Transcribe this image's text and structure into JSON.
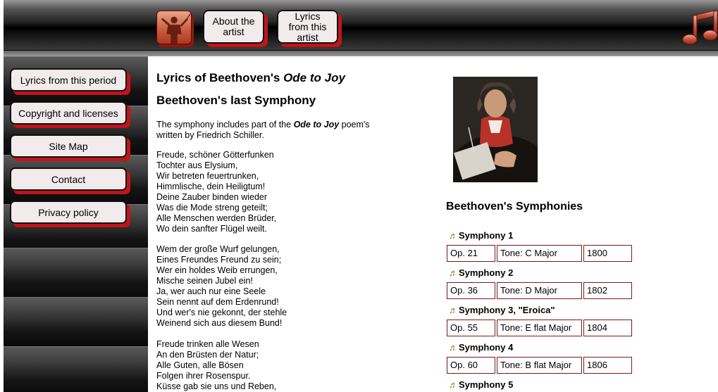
{
  "header": {
    "about_label": "About the artist",
    "lyrics_artist_label": "Lyrics from this artist",
    "logo_icon": "conductor-icon",
    "note_icon": "music-note-icon"
  },
  "sidebar": {
    "items": [
      {
        "label": "Lyrics from this period"
      },
      {
        "label": "Copyright and licenses"
      },
      {
        "label": "Site Map"
      },
      {
        "label": "Contact"
      },
      {
        "label": "Privacy policy"
      }
    ]
  },
  "main": {
    "title_prefix": "Lyrics of Beethoven's ",
    "title_italic": "Ode to Joy",
    "subtitle": "Beethoven's last Symphony",
    "intro_before": "The symphony includes part of the ",
    "intro_italic": "Ode to Joy",
    "intro_after": " poem's written by Friedrich Schiller.",
    "stanzas": [
      "Freude, schöner Götterfunken\nTochter aus Elysium,\nWir betreten feuertrunken,\nHimmlische, dein Heiligtum!\nDeine Zauber binden wieder\nWas die Mode streng geteilt;\nAlle Menschen werden Brüder,\nWo dein sanfter Flügel weilt.",
      "Wem der große Wurf gelungen,\nEines Freundes Freund zu sein;\nWer ein holdes Weib errungen,\nMische seinen Jubel ein!\nJa, wer auch nur eine Seele\nSein nennt auf dem Erdenrund!\nUnd wer's nie gekonnt, der stehle\nWeinend sich aus diesem Bund!",
      "Freude trinken alle Wesen\nAn den Brüsten der Natur;\nAlle Guten, alle Bösen\nFolgen ihrer Rosenspur.\nKüsse gab sie uns und Reben,"
    ]
  },
  "symphonies": {
    "heading": "Beethoven's Symphonies",
    "note_glyph": "♬",
    "items": [
      {
        "title": "Symphony 1",
        "opus": "Op. 21",
        "tone": "Tone: C Major",
        "year": "1800"
      },
      {
        "title": "Symphony 2",
        "opus": "Op. 36",
        "tone": "Tone: D Major",
        "year": "1802"
      },
      {
        "title": "Symphony 3, \"Eroica\"",
        "opus": "Op. 55",
        "tone": "Tone: E flat Major",
        "year": "1804"
      },
      {
        "title": "Symphony 4",
        "opus": "Op. 60",
        "tone": "Tone: B flat Major",
        "year": "1806"
      },
      {
        "title": "Symphony 5"
      }
    ]
  },
  "colors": {
    "button_shadow": "#c0141a",
    "button_bg": "#f1ebeb",
    "cell_border": "#7a1a1a"
  }
}
